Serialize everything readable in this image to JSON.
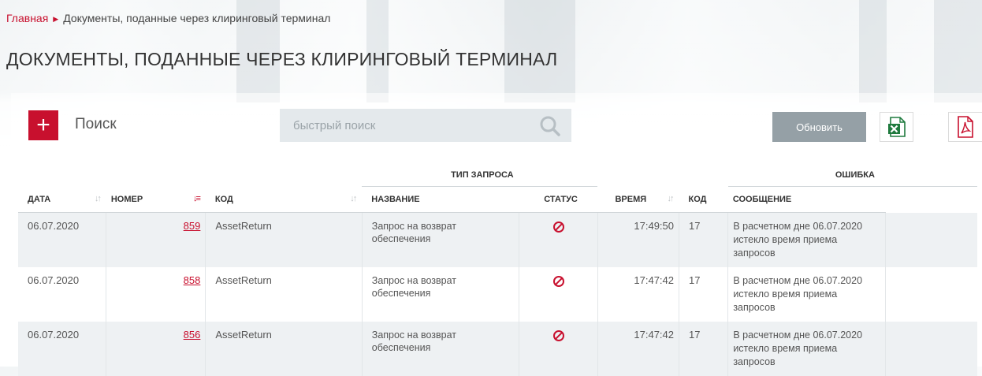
{
  "breadcrumb": {
    "home": "Главная",
    "current": "Документы, поданные через клиринговый терминал"
  },
  "page_title": "ДОКУМЕНТЫ, ПОДАННЫЕ ЧЕРЕЗ КЛИРИНГОВЫЙ ТЕРМИНАЛ",
  "toolbar": {
    "search_label": "Поиск",
    "quick_search_placeholder": "быстрый поиск",
    "refresh_label": "Обновить"
  },
  "table": {
    "group_headers": {
      "request_type": "ТИП ЗАПРОСА",
      "error": "ОШИБКА"
    },
    "columns": {
      "date": "ДАТА",
      "number": "НОМЕР",
      "code": "КОД",
      "name": "НАЗВАНИЕ",
      "status": "СТАТУС",
      "time": "ВРЕМЯ",
      "error_code": "КОД",
      "message": "СООБЩЕНИЕ"
    },
    "rows": [
      {
        "date": "06.07.2020",
        "number": "859",
        "code": "AssetReturn",
        "name": "Запрос на возврат обеспечения",
        "status": "rejected",
        "time": "17:49:50",
        "error_code": "17",
        "message": "В расчетном дне 06.07.2020 истекло время приема запросов"
      },
      {
        "date": "06.07.2020",
        "number": "858",
        "code": "AssetReturn",
        "name": "Запрос на возврат обеспечения",
        "status": "rejected",
        "time": "17:47:42",
        "error_code": "17",
        "message": "В расчетном дне 06.07.2020 истекло время приема запросов"
      },
      {
        "date": "06.07.2020",
        "number": "856",
        "code": "AssetReturn",
        "name": "Запрос на возврат обеспечения",
        "status": "rejected",
        "time": "17:47:42",
        "error_code": "17",
        "message": "В расчетном дне 06.07.2020 истекло время приема запросов"
      }
    ]
  },
  "colors": {
    "accent": "#c8102e",
    "button_gray": "#95a0a6",
    "excel_green": "#1f7a3e",
    "row_stripe": "#eef1f3"
  },
  "icons": {
    "add": "plus-icon",
    "search": "search-icon",
    "excel": "excel-icon",
    "pdf": "pdf-icon",
    "status": "prohibited-icon"
  }
}
